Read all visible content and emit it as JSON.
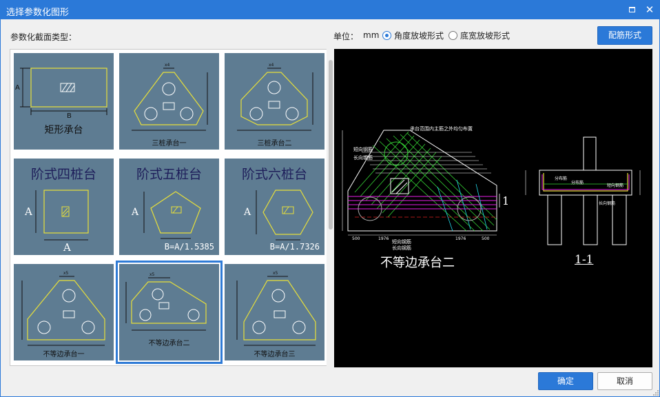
{
  "window": {
    "title": "选择参数化图形",
    "maximize_icon": "maximize-icon",
    "close_icon": "close-icon",
    "close_glyph": "✕"
  },
  "toolbar": {
    "section_type_label": "参数化截面类型：",
    "unit_label": "单位：",
    "unit_value": "mm",
    "slope_options": [
      {
        "label": "角度放坡形式",
        "checked": true
      },
      {
        "label": "底宽放坡形式",
        "checked": false
      }
    ],
    "rebar_button": "配筋形式"
  },
  "gallery": {
    "tiles": [
      {
        "caption": "矩形承台",
        "dim_a": "A",
        "dim_b": "B"
      },
      {
        "caption": "三桩承台一",
        "dim_top": "x4"
      },
      {
        "caption": "三桩承台二",
        "dim_top": "x4"
      },
      {
        "caption": "阶式四桩台",
        "dim_a": "A",
        "dim_b": "A"
      },
      {
        "caption": "阶式五桩台",
        "dim_a": "A",
        "formula": "B=A/1.5385"
      },
      {
        "caption": "阶式六桩台",
        "dim_a": "A",
        "formula": "B=A/1.7326"
      },
      {
        "caption": "不等边承台一",
        "dim_top": "x5"
      },
      {
        "caption": "不等边承台二",
        "selected": true,
        "dim_top": "x5"
      },
      {
        "caption": "不等边承台三",
        "dim_top": "x5"
      }
    ]
  },
  "preview": {
    "caption": "不等边承台二",
    "section_tag": "1-1",
    "section_mark": "1",
    "annotations": {
      "top_note": "承台范围内主筋之外均匀布置",
      "side_note_1": "短向钢筋",
      "side_note_2": "长向钢筋",
      "bottom_note_1": "短向钢筋",
      "bottom_note_2": "长向钢筋",
      "dims": [
        "500",
        "1976",
        "1976",
        "500"
      ],
      "section_labels": [
        "分布筋",
        "分布筋",
        "短向钢筋",
        "长向钢筋"
      ]
    }
  },
  "footer": {
    "ok_label": "确定",
    "cancel_label": "取消"
  },
  "colors": {
    "accent": "#2b79d8",
    "tile_bg": "#5e7c92",
    "preview_bg": "#000000"
  }
}
